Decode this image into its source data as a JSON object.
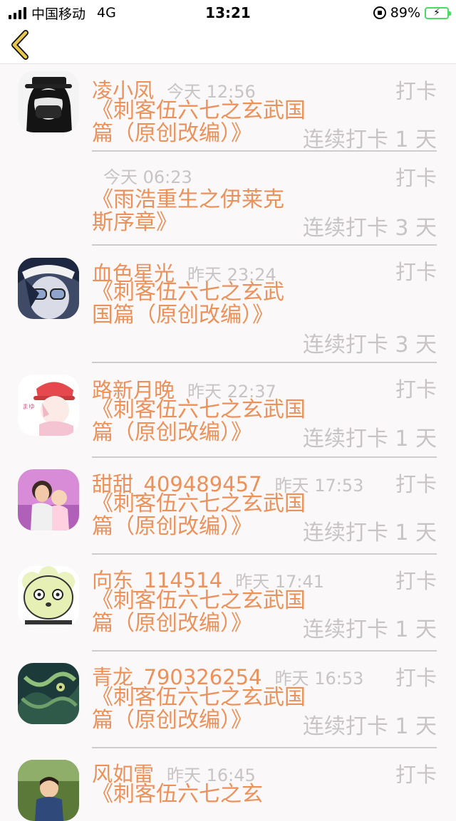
{
  "status_bar": {
    "carrier": "中国移动",
    "network": "4G",
    "time": "13:21",
    "battery": "89%",
    "accent": "#4cd964"
  },
  "nav": {
    "back_icon": "chevron-left-icon",
    "back_color": "#e8c84a"
  },
  "colors": {
    "name": "#ed915a",
    "muted": "#c8c4c6",
    "divider": "#cfcccd"
  },
  "entries": [
    {
      "name": "凌小凤",
      "time": "今天 12:56",
      "action": "打卡",
      "title": "《刺客伍六七之玄武国篇（原创改编）》",
      "streak": "连续打卡 1 天",
      "avatar": "avatar-hat-mask"
    },
    {
      "name": "",
      "time": "今天 06:23",
      "action": "打卡",
      "title": "《雨浩重生之伊莱克斯序章》",
      "streak": "连续打卡 3 天",
      "avatar": ""
    },
    {
      "name": "血色星光",
      "time": "昨天 23:24",
      "action": "打卡",
      "title": "《刺客伍六七之玄武国篇（原创改编）》",
      "streak": "连续打卡 3 天",
      "avatar": "avatar-anime-boy"
    },
    {
      "name": "路新月晚",
      "time": "昨天 22:37",
      "action": "打卡",
      "title": "《刺客伍六七之玄武国篇（原创改编）》",
      "streak": "连续打卡 1 天",
      "avatar": "avatar-red-cap"
    },
    {
      "name": "甜甜_409489457",
      "time": "昨天 17:53",
      "action": "打卡",
      "title": "《刺客伍六七之玄武国篇（原创改编）》",
      "streak": "连续打卡 1 天",
      "avatar": "avatar-girls-photo"
    },
    {
      "name": "向东_114514",
      "time": "昨天 17:41",
      "action": "打卡",
      "title": "《刺客伍六七之玄武国篇（原创改编）》",
      "streak": "连续打卡 1 天",
      "avatar": "avatar-cartoon-sheep"
    },
    {
      "name": "青龙_790326254",
      "time": "昨天 16:53",
      "action": "打卡",
      "title": "《刺客伍六七之玄武国篇（原创改编）》",
      "streak": "连续打卡 1 天",
      "avatar": "avatar-dragon"
    },
    {
      "name": "风如雷",
      "time": "昨天 16:45",
      "action": "打卡",
      "title": "《刺客伍六七之玄",
      "streak": "",
      "avatar": "avatar-child-photo"
    }
  ]
}
